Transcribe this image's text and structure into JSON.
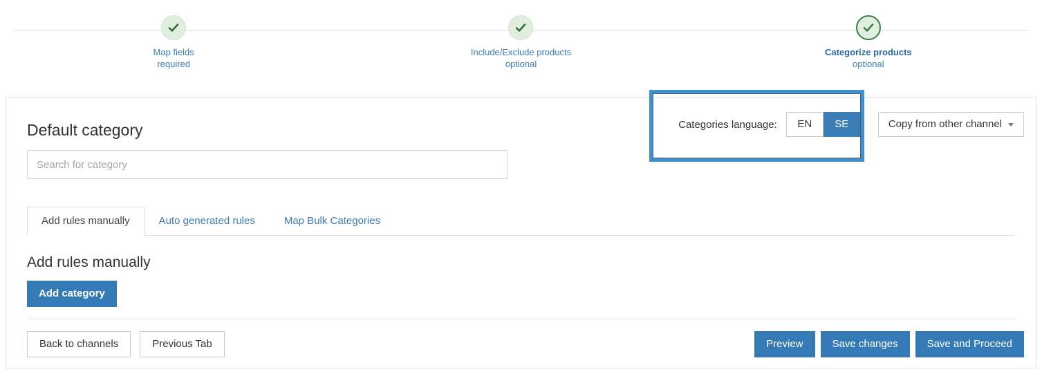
{
  "stepper": {
    "steps": [
      {
        "label": "Map fields",
        "sub": "required",
        "state": "complete",
        "icon": "check-icon"
      },
      {
        "label": "Include/Exclude products",
        "sub": "optional",
        "state": "complete",
        "icon": "check-icon"
      },
      {
        "label": "Categorize products",
        "sub": "optional",
        "state": "active",
        "icon": "check-icon"
      }
    ]
  },
  "language": {
    "label": "Categories language:",
    "options": [
      "EN",
      "SE"
    ],
    "selected": "SE",
    "copy_button": "Copy from other channel",
    "copy_icon": "chevron-down-icon"
  },
  "default_category": {
    "title": "Default category",
    "search_placeholder": "Search for category",
    "search_value": ""
  },
  "tabs": [
    {
      "label": "Add rules manually",
      "active": true
    },
    {
      "label": "Auto generated rules",
      "active": false
    },
    {
      "label": "Map Bulk Categories",
      "active": false
    }
  ],
  "rules": {
    "title": "Add rules manually",
    "add_button": "Add category"
  },
  "footer": {
    "back": "Back to channels",
    "previous": "Previous Tab",
    "preview": "Preview",
    "save": "Save changes",
    "save_proceed": "Save and Proceed"
  },
  "colors": {
    "primary_blue": "#337ab7",
    "toggle_blue": "#3a7eb5",
    "link_blue": "#3c7bb5",
    "step_green": "#3a7d44",
    "step_green_fill": "#dfeedd",
    "highlight_blue": "#3d91d1"
  }
}
